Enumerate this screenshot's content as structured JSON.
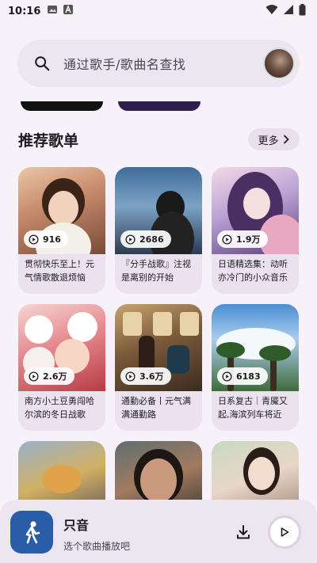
{
  "status_bar": {
    "time": "10:16"
  },
  "search": {
    "placeholder": "通过歌手/歌曲名查找"
  },
  "section": {
    "title": "推荐歌单",
    "more_label": "更多"
  },
  "playlists": [
    {
      "count": "916",
      "title": "贯彻快乐至上！元气情歌散退烦恼"
    },
    {
      "count": "2686",
      "title": "『分手战歌』注视是离别的开始"
    },
    {
      "count": "1.9万",
      "title": "日语精选集：动听亦冷门的小众音乐"
    },
    {
      "count": "2.6万",
      "title": "南方小土豆勇闯哈尔滨的冬日战歌"
    },
    {
      "count": "3.6万",
      "title": "通勤必备丨元气满满通勤路"
    },
    {
      "count": "6183",
      "title": "日系复古｜青魇又起,海滨列车将近"
    },
    {
      "count": "",
      "title": ""
    },
    {
      "count": "",
      "title": ""
    },
    {
      "count": "",
      "title": ""
    }
  ],
  "player": {
    "title": "只音",
    "subtitle": "选个歌曲播放吧"
  },
  "colors": {
    "background": "#f7f1fa",
    "search_bg": "#ece6f1",
    "accent": "#2a5da8"
  }
}
